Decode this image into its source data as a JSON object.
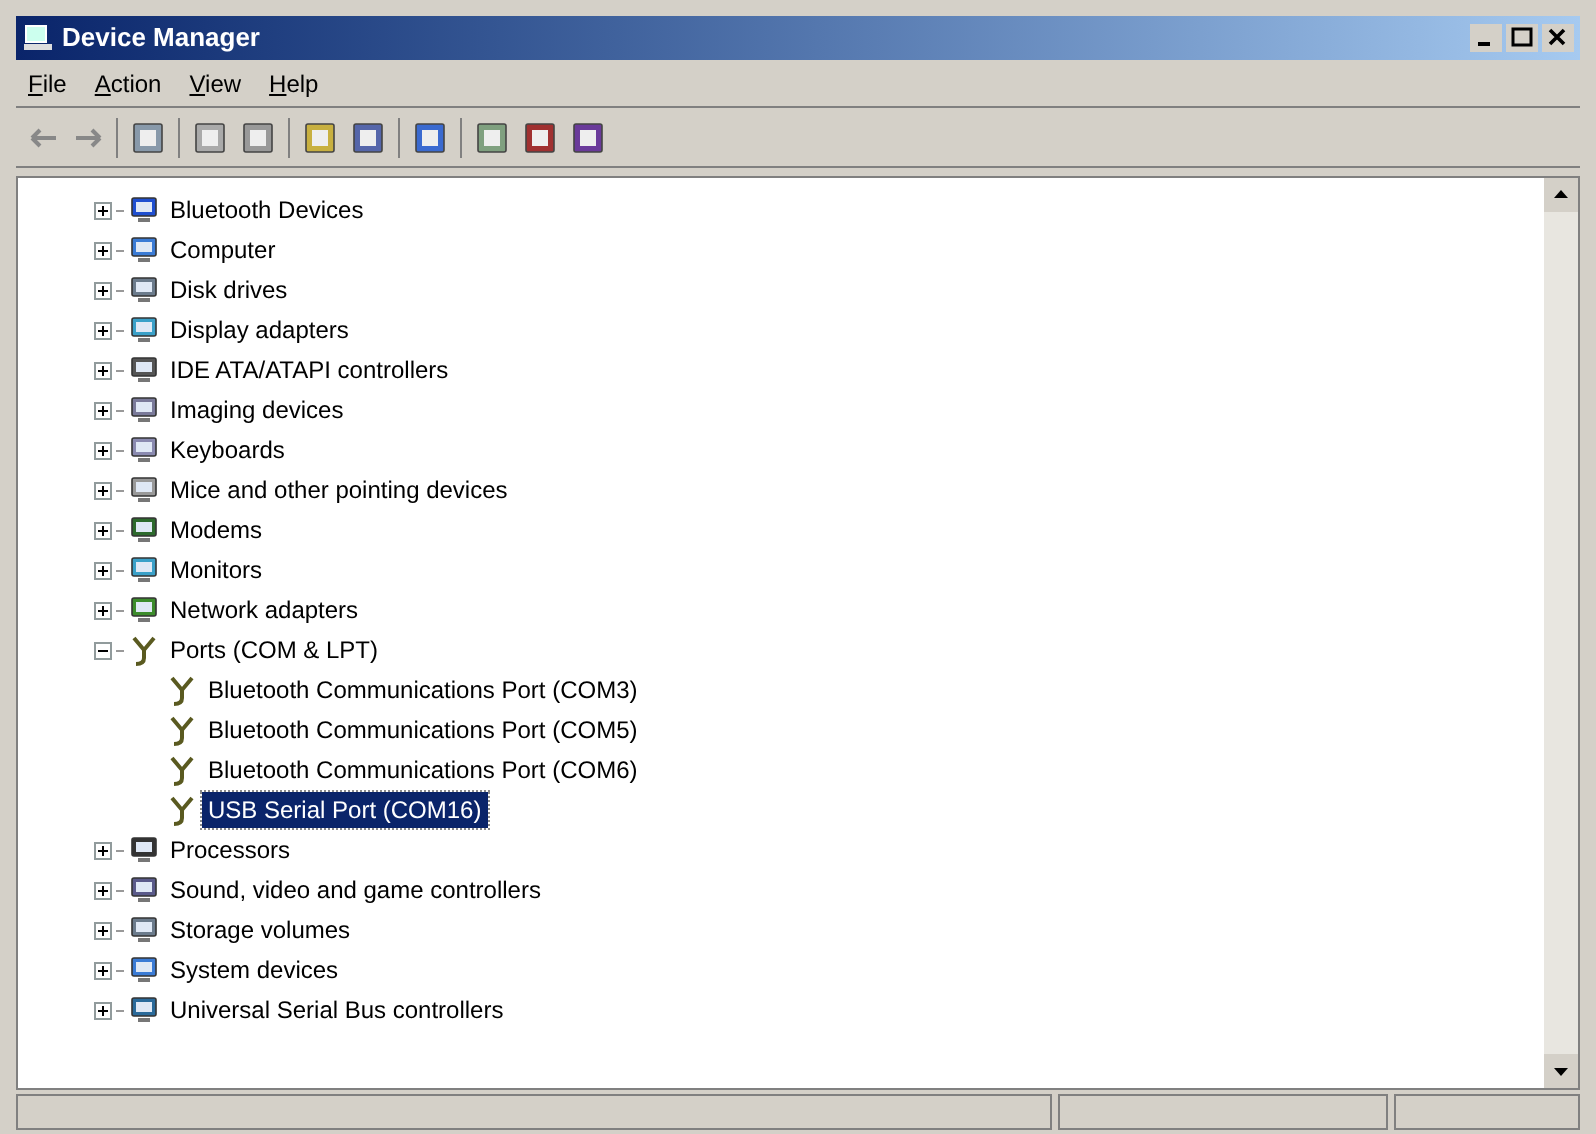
{
  "window": {
    "title": "Device Manager"
  },
  "menu": [
    "File",
    "Action",
    "View",
    "Help"
  ],
  "tree": [
    {
      "label": "Bluetooth Devices",
      "expanded": false
    },
    {
      "label": "Computer",
      "expanded": false
    },
    {
      "label": "Disk drives",
      "expanded": false
    },
    {
      "label": "Display adapters",
      "expanded": false
    },
    {
      "label": "IDE ATA/ATAPI controllers",
      "expanded": false
    },
    {
      "label": "Imaging devices",
      "expanded": false
    },
    {
      "label": "Keyboards",
      "expanded": false
    },
    {
      "label": "Mice and other pointing devices",
      "expanded": false
    },
    {
      "label": "Modems",
      "expanded": false
    },
    {
      "label": "Monitors",
      "expanded": false
    },
    {
      "label": "Network adapters",
      "expanded": false
    },
    {
      "label": "Ports (COM & LPT)",
      "expanded": true,
      "children": [
        {
          "label": "Bluetooth Communications Port (COM3)",
          "selected": false
        },
        {
          "label": "Bluetooth Communications Port (COM5)",
          "selected": false
        },
        {
          "label": "Bluetooth Communications Port (COM6)",
          "selected": false
        },
        {
          "label": "USB Serial Port (COM16)",
          "selected": true
        }
      ]
    },
    {
      "label": "Processors",
      "expanded": false
    },
    {
      "label": "Sound, video and game controllers",
      "expanded": false
    },
    {
      "label": "Storage volumes",
      "expanded": false
    },
    {
      "label": "System devices",
      "expanded": false
    },
    {
      "label": "Universal Serial Bus controllers",
      "expanded": false
    }
  ]
}
